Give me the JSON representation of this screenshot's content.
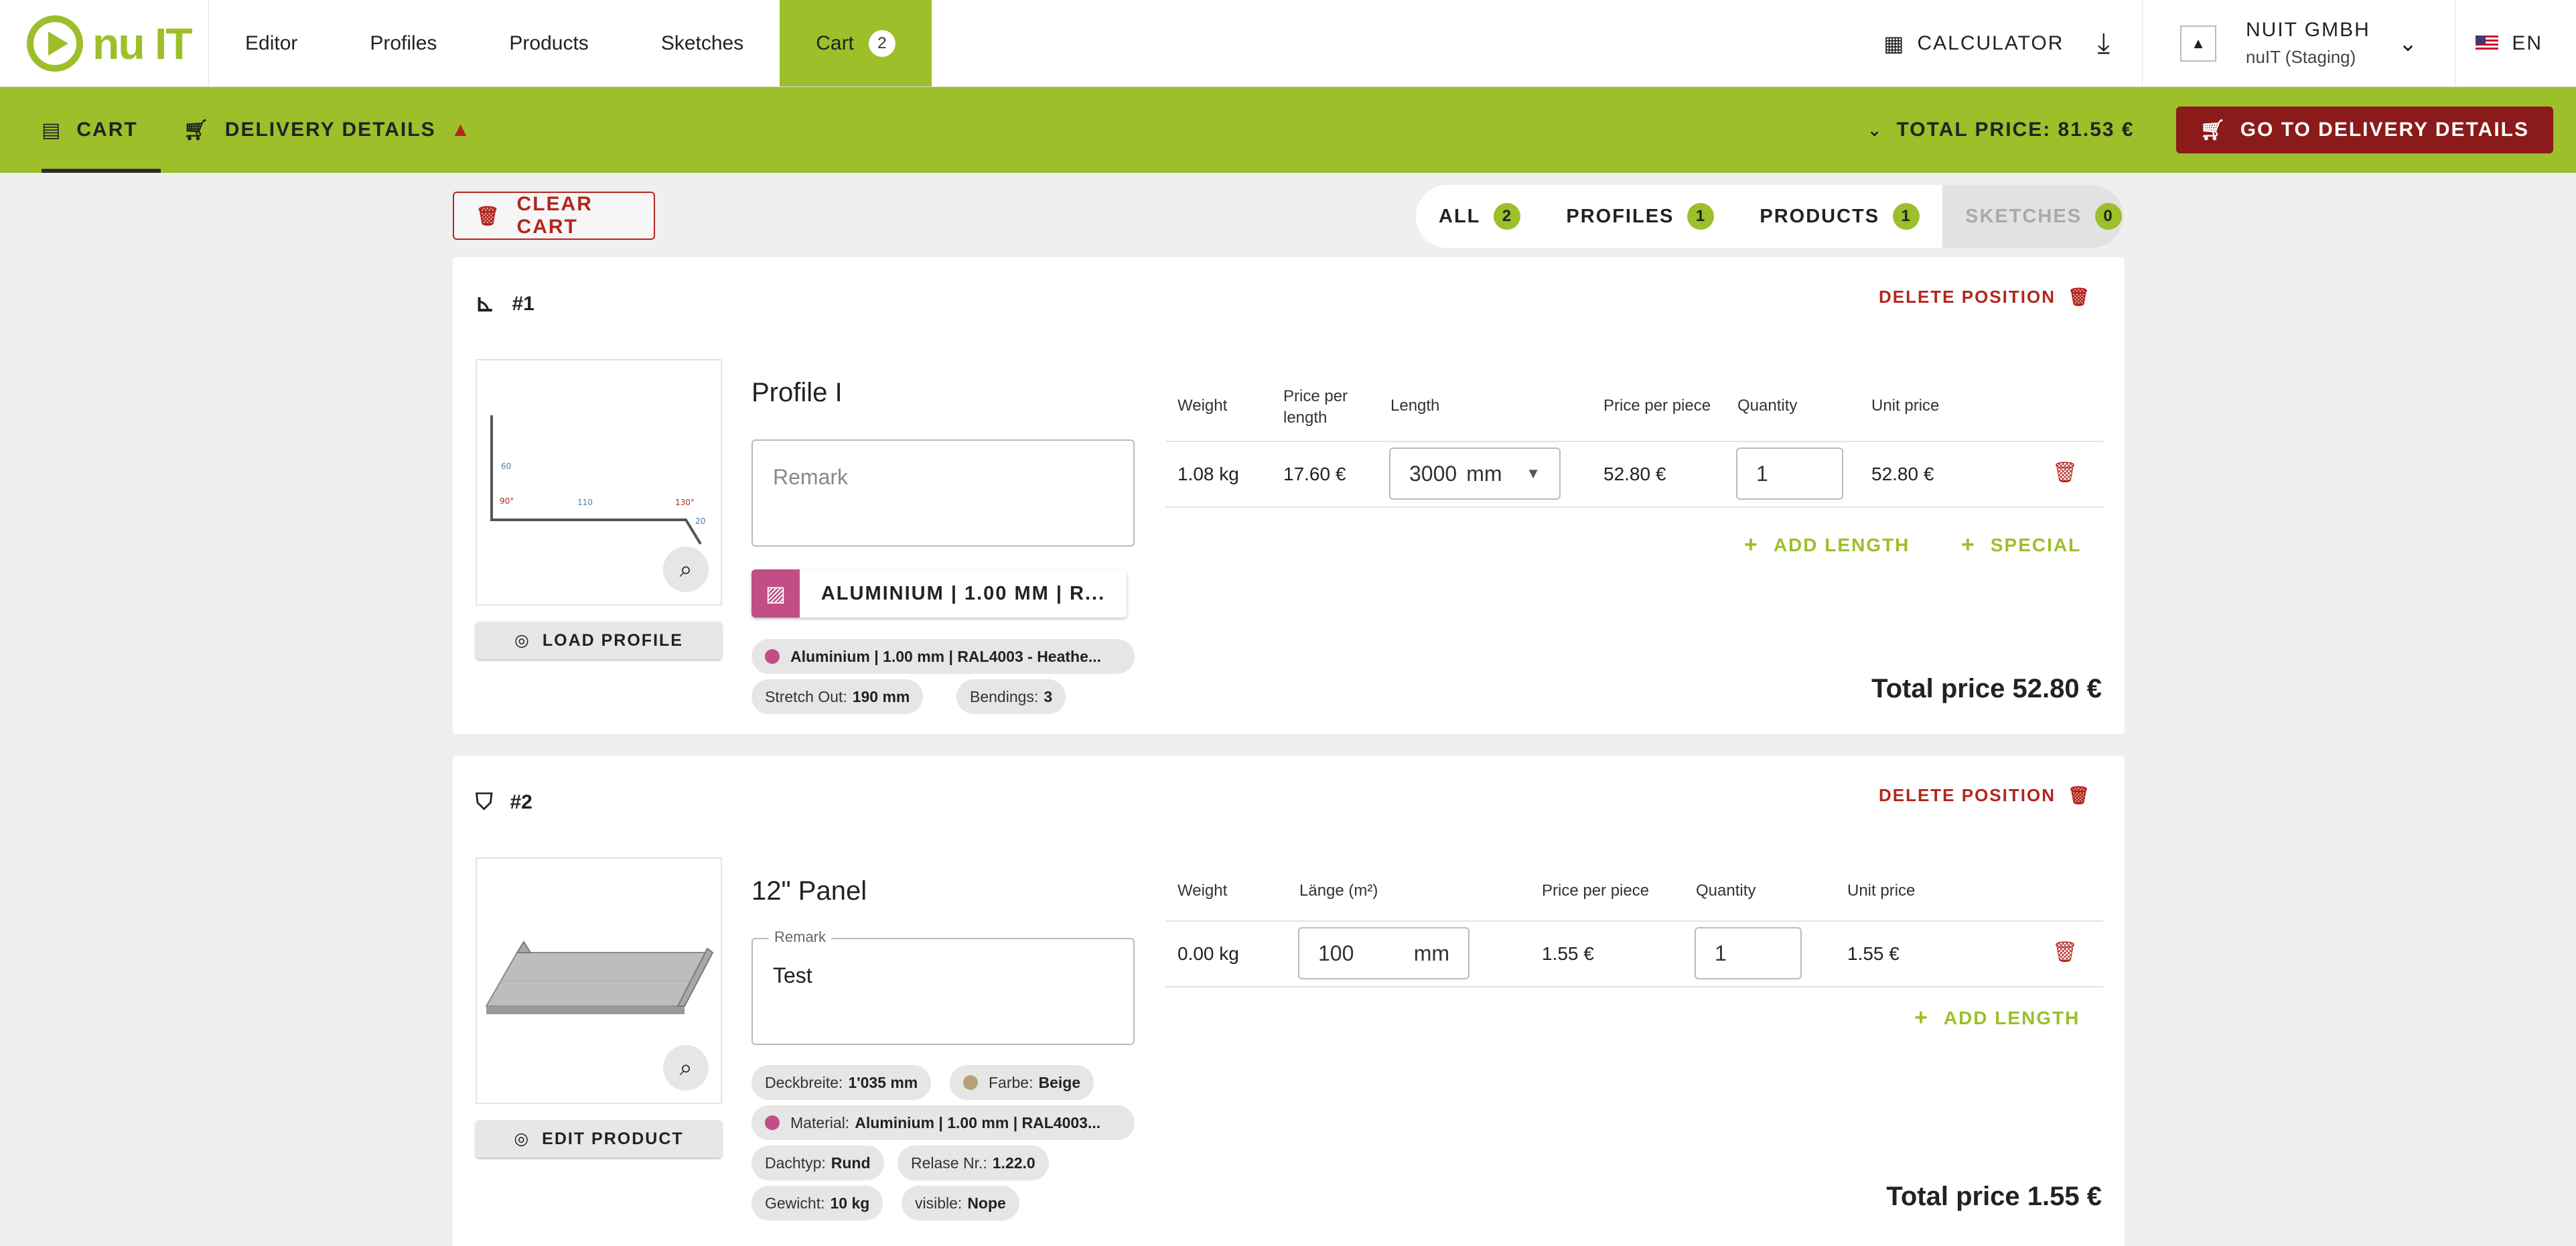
{
  "brand": {
    "logo_text": "nu IT",
    "accent": "#9cbf2a",
    "danger": "#b3261e",
    "dark_red": "#8b1a1a"
  },
  "nav": {
    "items": [
      "Editor",
      "Profiles",
      "Products",
      "Sketches"
    ],
    "cart_label": "Cart",
    "cart_count": "2",
    "calculator_label": "CALCULATOR",
    "company_name": "NUIT GMBH",
    "company_sub": "nuIT (Staging)",
    "language": "EN"
  },
  "subnav": {
    "cart_tab": "CART",
    "delivery_tab": "DELIVERY DETAILS",
    "total_price": "TOTAL PRICE: 81.53 €",
    "go_button": "GO TO DELIVERY DETAILS"
  },
  "toolbar": {
    "clear_cart": "CLEAR CART",
    "filters": [
      {
        "label": "ALL",
        "count": "2"
      },
      {
        "label": "PROFILES",
        "count": "1"
      },
      {
        "label": "PRODUCTS",
        "count": "1"
      },
      {
        "label": "SKETCHES",
        "count": "0"
      }
    ]
  },
  "positions": [
    {
      "number": "#1",
      "delete_label": "DELETE POSITION",
      "button_label": "LOAD PROFILE",
      "title": "Profile I",
      "remark_placeholder": "Remark",
      "material_button": "ALUMINIUM | 1.00 MM | R...",
      "material_color": "#c14e87",
      "chips": {
        "material": "Aluminium | 1.00 mm | RAL4003 - Heathe...",
        "stretch_label": "Stretch Out:",
        "stretch_value": "190 mm",
        "bendings_label": "Bendings:",
        "bendings_value": "3"
      },
      "sketch_labels": {
        "a": "60",
        "b": "110",
        "c": "20",
        "angle1": "90°",
        "angle2": "130°"
      },
      "headers": {
        "weight": "Weight",
        "price_per_length": "Price per length",
        "length": "Length",
        "price_per_piece": "Price per piece",
        "quantity": "Quantity",
        "unit_price": "Unit price"
      },
      "row": {
        "weight": "1.08 kg",
        "price_per_length": "17.60 €",
        "length": "3000",
        "length_unit": "mm",
        "price_per_piece": "52.80 €",
        "quantity": "1",
        "unit_price": "52.80 €"
      },
      "add_length": "ADD LENGTH",
      "special": "SPECIAL",
      "total": "Total price 52.80 €"
    },
    {
      "number": "#2",
      "delete_label": "DELETE POSITION",
      "button_label": "EDIT PRODUCT",
      "title": "12\" Panel",
      "remark_legend": "Remark",
      "remark_value": "Test",
      "chips": {
        "deckbreite_label": "Deckbreite:",
        "deckbreite_value": "1'035 mm",
        "farbe_label": "Farbe:",
        "farbe_value": "Beige",
        "farbe_color": "#b8a07a",
        "material_label": "Material:",
        "material_value": "Aluminium | 1.00 mm | RAL4003...",
        "material_color": "#c14e87",
        "dachtyp_label": "Dachtyp:",
        "dachtyp_value": "Rund",
        "relase_label": "Relase Nr.:",
        "relase_value": "1.22.0",
        "gewicht_label": "Gewicht:",
        "gewicht_value": "10 kg",
        "visible_label": "visible:",
        "visible_value": "Nope"
      },
      "headers": {
        "weight": "Weight",
        "laenge": "Länge (m²)",
        "price_per_piece": "Price per piece",
        "quantity": "Quantity",
        "unit_price": "Unit price"
      },
      "row": {
        "weight": "0.00 kg",
        "laenge": "100",
        "laenge_unit": "mm",
        "price_per_piece": "1.55 €",
        "quantity": "1",
        "unit_price": "1.55 €"
      },
      "add_length": "ADD LENGTH",
      "total": "Total price 1.55 €"
    }
  ]
}
